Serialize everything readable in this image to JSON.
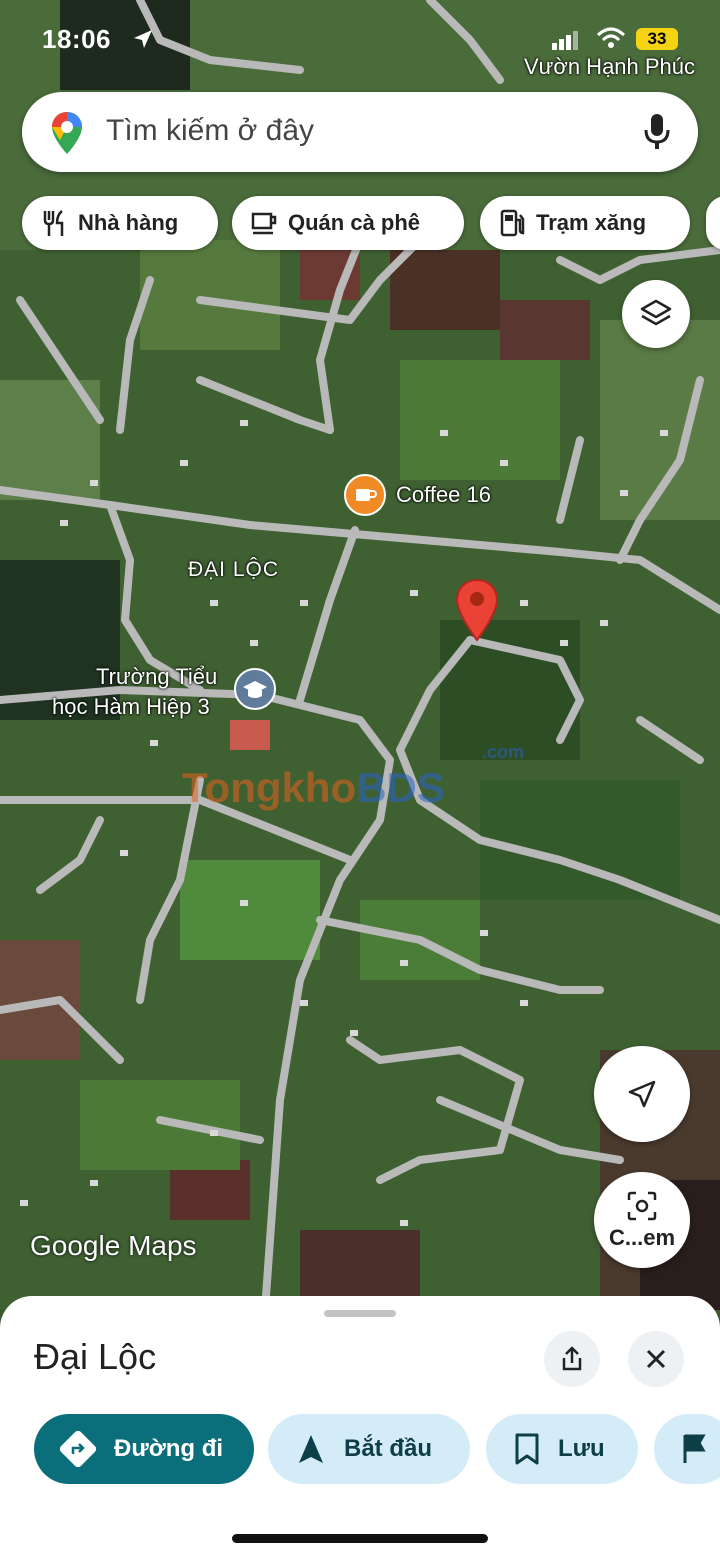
{
  "status_bar": {
    "time": "18:06",
    "battery": "33"
  },
  "map": {
    "labels": {
      "vuon_hanh_phuc": "Vườn Hạnh Phúc",
      "dai_loc": "ĐẠI LỘC",
      "school_line1": "Trường Tiểu",
      "school_line2": "học Hàm Hiệp 3",
      "coffee": "Coffee 16"
    },
    "watermark_part1": "Tongkho",
    "watermark_part2": "BDS",
    "watermark_small": ".com",
    "google_logo": "Google Maps"
  },
  "search": {
    "placeholder": "Tìm kiếm ở đây"
  },
  "chips": [
    {
      "label": "Nhà hàng",
      "icon": "restaurant-icon"
    },
    {
      "label": "Quán cà phê",
      "icon": "coffee-cup-icon"
    },
    {
      "label": "Trạm xăng",
      "icon": "gas-station-icon"
    }
  ],
  "camera_button": {
    "label": "C...em"
  },
  "sheet": {
    "title": "Đại Lộc",
    "actions": [
      {
        "label": "Đường đi",
        "icon": "directions-icon"
      },
      {
        "label": "Bắt đầu",
        "icon": "navigation-arrow-icon"
      },
      {
        "label": "Lưu",
        "icon": "bookmark-icon"
      }
    ]
  },
  "colors": {
    "accent_teal": "#0b6e7b",
    "light_blue_chip": "#d3ecf7",
    "pin_red": "#ea4335",
    "poi_orange": "#f08a24",
    "poi_school": "#5f7d9b"
  }
}
